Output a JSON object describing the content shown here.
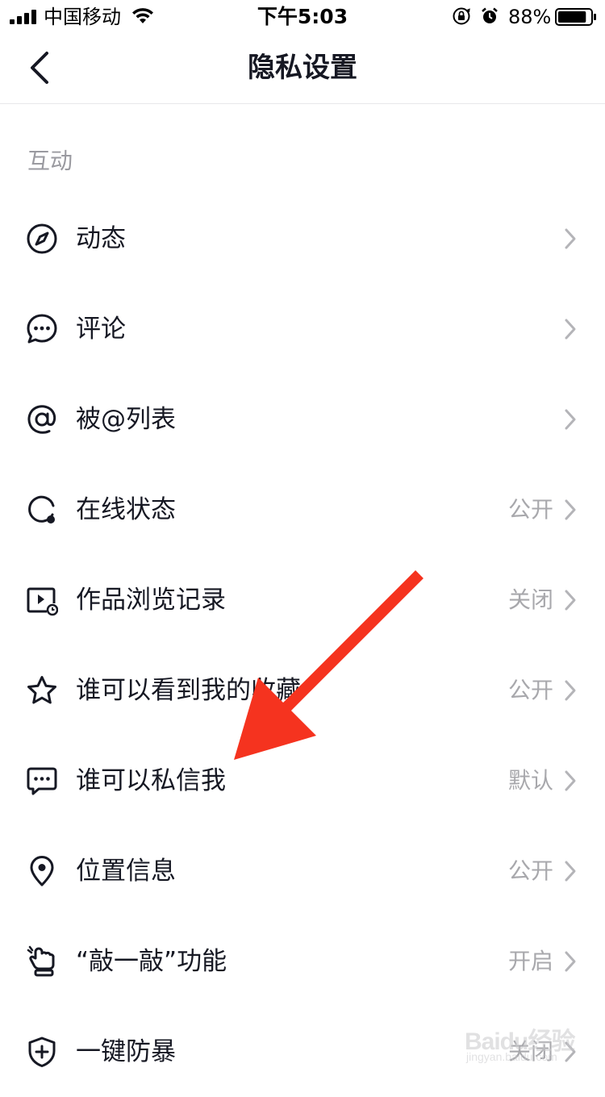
{
  "status_bar": {
    "carrier": "中国移动",
    "time": "下午5:03",
    "battery_percent": "88%",
    "battery_level": 0.88
  },
  "nav": {
    "title": "隐私设置"
  },
  "section": {
    "title": "互动"
  },
  "items": [
    {
      "label": "动态",
      "value": "",
      "icon": "compass-icon"
    },
    {
      "label": "评论",
      "value": "",
      "icon": "comment-icon"
    },
    {
      "label": "被@列表",
      "value": "",
      "icon": "at-icon"
    },
    {
      "label": "在线状态",
      "value": "公开",
      "icon": "online-status-icon"
    },
    {
      "label": "作品浏览记录",
      "value": "关闭",
      "icon": "video-history-icon"
    },
    {
      "label": "谁可以看到我的收藏",
      "value": "公开",
      "icon": "star-icon"
    },
    {
      "label": "谁可以私信我",
      "value": "默认",
      "icon": "message-icon"
    },
    {
      "label": "位置信息",
      "value": "公开",
      "icon": "location-icon"
    },
    {
      "label": "“敲一敲”功能",
      "value": "开启",
      "icon": "knock-icon"
    },
    {
      "label": "一键防暴",
      "value": "关闭",
      "icon": "shield-plus-icon"
    }
  ],
  "annotation": {
    "color": "#f5331f"
  },
  "watermark": {
    "logo": "Baidu经验",
    "url": "jingyan.baidu.com"
  },
  "colors": {
    "text_primary": "#161823",
    "text_secondary": "#a8a8ac",
    "section_header": "#9a9aa0",
    "divider": "#e8e8ea"
  }
}
